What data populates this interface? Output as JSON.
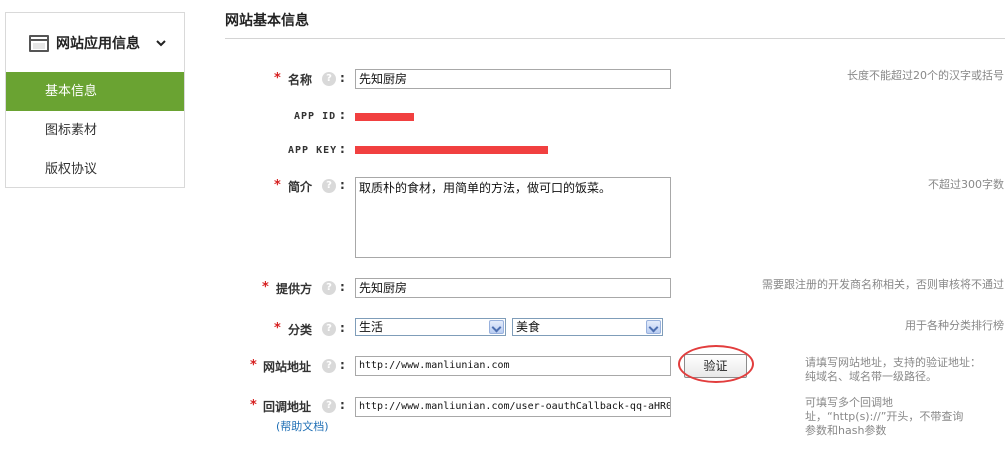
{
  "sidebar": {
    "title": "网站应用信息",
    "items": [
      {
        "label": "基本信息",
        "active": true
      },
      {
        "label": "图标素材",
        "active": false
      },
      {
        "label": "版权协议",
        "active": false
      }
    ]
  },
  "main": {
    "title": "网站基本信息"
  },
  "form": {
    "required_mark": "*",
    "help_glyph": "?",
    "colon": ":",
    "name": {
      "label": "名称",
      "value": "先知厨房",
      "hint": "长度不能超过20个的汉字或括号"
    },
    "app_id": {
      "label": "APP ID"
    },
    "app_key": {
      "label": "APP KEY"
    },
    "intro": {
      "label": "简介",
      "value": "取质朴的食材，用简单的方法，做可口的饭菜。",
      "hint": "不超过300字数"
    },
    "provider": {
      "label": "提供方",
      "value": "先知厨房",
      "hint": "需要跟注册的开发商名称相关，否则审核将不通过"
    },
    "category": {
      "label": "分类",
      "primary": "生活",
      "secondary": "美食",
      "hint": "用于各种分类排行榜"
    },
    "site_url": {
      "label": "网站地址",
      "value": "http://www.manliunian.com",
      "button": "验证",
      "hint_line1": "请填写网站地址，支持的验证地址：",
      "hint_line2": "纯域名、域名带一级路径。"
    },
    "callback_url": {
      "label": "回调地址",
      "value": "http://www.manliunian.com/user-oauthCallback-qq-aHR0",
      "help_link": "(帮助文档)",
      "hint_line1": "可填写多个回调地",
      "hint_line2": "址，“http(s)://”开头，不带查询",
      "hint_line3": "参数和hash参数"
    }
  },
  "colors": {
    "active_green": "#6aa332",
    "required_red": "#d62020",
    "mask_red": "#f14040",
    "link_blue": "#1f6fb5"
  }
}
